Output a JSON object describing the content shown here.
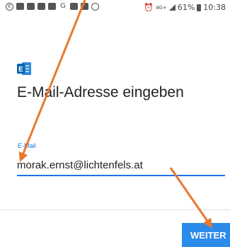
{
  "status_bar": {
    "left_icons": [
      "whatsapp-icon",
      "notification-icon",
      "notification-icon",
      "notification-icon",
      "notification-icon",
      "google-icon",
      "notification-icon",
      "image-icon",
      "camera-icon"
    ],
    "google_letter": "G",
    "network": "4G+",
    "battery": "61%",
    "time": "10:38"
  },
  "app": {
    "logo": "exchange-logo-icon",
    "title": "E-Mail-Adresse eingeben"
  },
  "email_field": {
    "label": "E-Mail",
    "value": "morak.ernst@lichtenfels.at"
  },
  "actions": {
    "next_label": "WEITER"
  },
  "colors": {
    "accent": "#1a73e8",
    "button": "#2b8bea",
    "logo": "#0a64ad",
    "annotation_arrow": "#e8782f"
  }
}
